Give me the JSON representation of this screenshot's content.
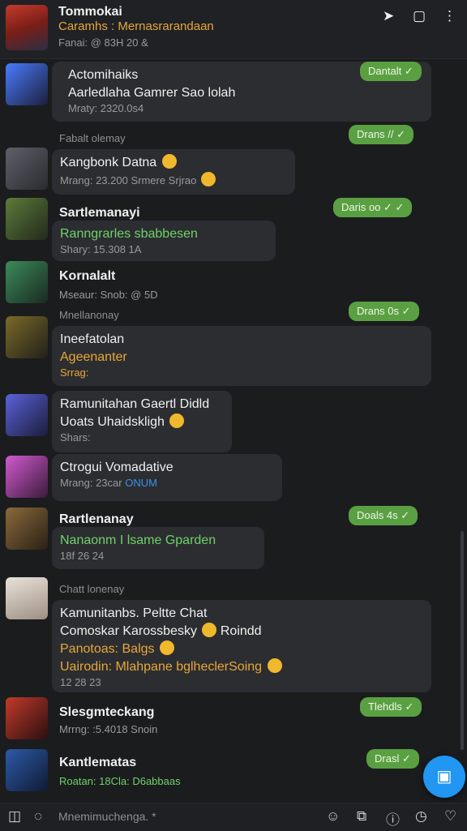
{
  "header": {
    "title": "Tommokai",
    "subtitle": "Caramhs : Mernasrarandaan",
    "meta": "Fanai: @ 83H 20 &",
    "icons": [
      "send-icon",
      "window-icon",
      "more-vert-icon"
    ]
  },
  "rows": [
    {
      "avatar_color": "#314a9e",
      "title": "Actomihaiks",
      "line2": "Aarledlaha Gamrer Sao lolah",
      "meta": "Mraty: 2320.0s4",
      "pill": "Dantalt"
    },
    {
      "label": "Fabalt olemay",
      "avatar_color": "#4b4d54",
      "title": "Kangbonk Datna",
      "meta": "Mrang: 23.200 Srmere Srjrao",
      "pill": "Drans //"
    },
    {
      "avatar_color": "#4b5b3b",
      "title": "Sartlemanayi",
      "line2": "Ranngrarles sbabbesen",
      "meta": "Shary: 15.308 1A",
      "pill": "Daris oo"
    },
    {
      "avatar_color": "#3c6b4a",
      "title": "Kornalalt",
      "meta": "Mseaur: Snob: @ 5D"
    },
    {
      "label": "Mnellanonay",
      "avatar_color": "#6b5a2b",
      "title": "Ineefatolan",
      "line2": "Ageenanter",
      "meta": "Srrag:",
      "pill": "Drans 0s"
    },
    {
      "avatar_color": "#3b3f8f",
      "title": "Ramunitahan Gaertl Didld",
      "line2": "Uoats Uhaidskligh",
      "meta": "Shars:"
    },
    {
      "avatar_color": "#a44aa0",
      "title": "Ctrogui Vomadative",
      "meta": "Mrang: 23car",
      "meta_blue": "ONUM"
    },
    {
      "avatar_color": "#6b5030",
      "title": "Rartlenanay",
      "line2": "Nanaonm I lsame Gparden",
      "meta": "18f 26 24",
      "pill": "Doals 4s"
    },
    {
      "label": "Chatt lonenay",
      "avatar_color": "#c9c1b8",
      "title": "Kamunitanbs. Peltte Chat",
      "line2": "Comoskar Karossbesky",
      "line2b": "Roindd",
      "line3": "Panotoas: Balgs",
      "line4": "Uairodin: Mlahpane bglheclerSoing",
      "meta": "12 28 23"
    },
    {
      "avatar_color": "#8a2a22",
      "title": "Slesgmteckang",
      "meta": "Mrrng: :5.4018 Snoin",
      "pill": "Tlehdls"
    },
    {
      "avatar_color": "#1f3f7a",
      "title": "Kantlematas",
      "meta": "Roatan: 18Cla: D6abbaas",
      "pill": "Drasl"
    }
  ],
  "bottom": {
    "input_placeholder": "Mnemimuchenga. *",
    "icons": [
      "sidebar-icon",
      "emoji-icon",
      "sticker-icon",
      "info-icon",
      "clock-icon",
      "heart-icon"
    ]
  }
}
